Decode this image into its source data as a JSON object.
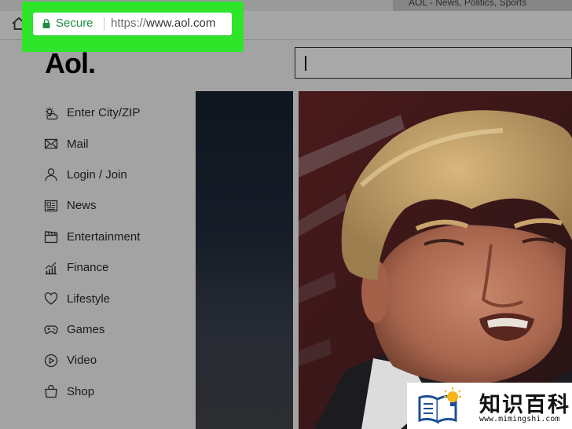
{
  "browser": {
    "tab_inactive_title": "AOL - News, Politics, Sports",
    "url_security_label": "Secure",
    "url_protocol": "https://",
    "url_host": "www.aol.com",
    "highlight_color": "#2ee52a",
    "secure_color": "#1e8e3e"
  },
  "site": {
    "logo_text": "Aol.",
    "search_value": ""
  },
  "sidebar": {
    "items": [
      {
        "label": "Enter City/ZIP",
        "icon": "weather-icon"
      },
      {
        "label": "Mail",
        "icon": "mail-icon"
      },
      {
        "label": "Login / Join",
        "icon": "user-icon"
      },
      {
        "label": "News",
        "icon": "news-icon"
      },
      {
        "label": "Entertainment",
        "icon": "clapperboard-icon"
      },
      {
        "label": "Finance",
        "icon": "finance-chart-icon"
      },
      {
        "label": "Lifestyle",
        "icon": "heart-icon"
      },
      {
        "label": "Games",
        "icon": "gamepad-icon"
      },
      {
        "label": "Video",
        "icon": "play-icon"
      },
      {
        "label": "Shop",
        "icon": "shopping-bag-icon"
      }
    ]
  },
  "watermark": {
    "title": "知识百科",
    "url": "www.mimingshi.com"
  }
}
